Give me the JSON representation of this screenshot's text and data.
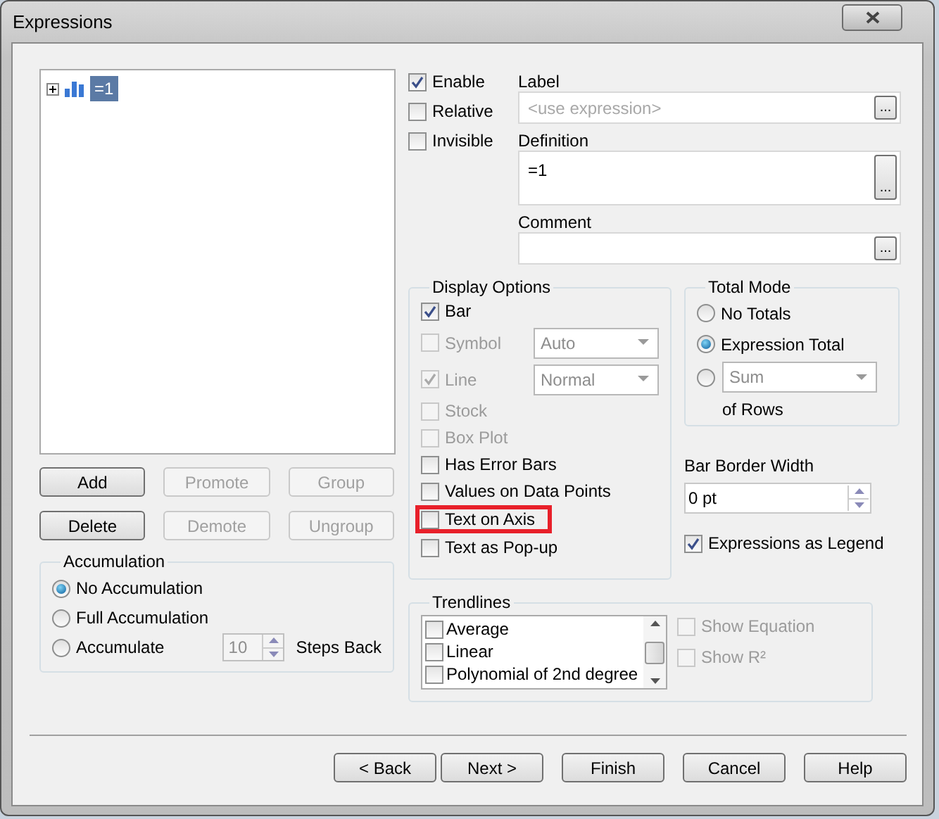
{
  "window": {
    "title": "Expressions"
  },
  "tree": {
    "items": [
      {
        "label": "=1",
        "selected": true,
        "expanded": false
      }
    ]
  },
  "list_buttons": [
    {
      "label": "Add",
      "disabled": false
    },
    {
      "label": "Promote",
      "disabled": true
    },
    {
      "label": "Group",
      "disabled": true
    },
    {
      "label": "Delete",
      "disabled": false
    },
    {
      "label": "Demote",
      "disabled": true
    },
    {
      "label": "Ungroup",
      "disabled": true
    }
  ],
  "accumulation": {
    "title": "Accumulation",
    "options": [
      {
        "label": "No Accumulation",
        "selected": true
      },
      {
        "label": "Full Accumulation",
        "selected": false
      },
      {
        "label": "Accumulate",
        "selected": false
      }
    ],
    "steps": {
      "value": "10",
      "label": "Steps Back",
      "disabled": true
    }
  },
  "flags": [
    {
      "label": "Enable",
      "checked": true
    },
    {
      "label": "Relative",
      "checked": false
    },
    {
      "label": "Invisible",
      "checked": false
    }
  ],
  "fields": [
    {
      "kind": "input",
      "label": "Label",
      "placeholder": "<use expression>",
      "button": "..."
    },
    {
      "kind": "textarea",
      "label": "Definition",
      "value": "=1",
      "button": "..."
    },
    {
      "kind": "input",
      "label": "Comment",
      "button": "..."
    }
  ],
  "display_options": {
    "title": "Display Options",
    "options": [
      {
        "kind": "check",
        "label": "Bar",
        "checked": true,
        "disabled": false,
        "highlighted": false
      },
      {
        "kind": "check_select",
        "label": "Symbol",
        "checked": false,
        "disabled": true,
        "select": "Auto",
        "highlighted": false
      },
      {
        "kind": "check_select",
        "label": "Line",
        "checked": true,
        "disabled": true,
        "select": "Normal",
        "highlighted": false
      },
      {
        "kind": "check",
        "label": "Stock",
        "checked": false,
        "disabled": true,
        "highlighted": false
      },
      {
        "kind": "check",
        "label": "Box Plot",
        "checked": false,
        "disabled": true,
        "highlighted": false
      },
      {
        "kind": "check",
        "label": "Has Error Bars",
        "checked": false,
        "disabled": false,
        "highlighted": false
      },
      {
        "kind": "check",
        "label": "Values on Data Points",
        "checked": false,
        "disabled": false,
        "highlighted": false
      },
      {
        "kind": "check",
        "label": "Text on Axis",
        "checked": false,
        "disabled": false,
        "highlighted": true
      },
      {
        "kind": "check",
        "label": "Text as Pop-up",
        "checked": false,
        "disabled": false,
        "highlighted": false
      }
    ]
  },
  "total_mode": {
    "title": "Total Mode",
    "options": [
      {
        "kind": "radio",
        "label": "No Totals",
        "selected": false
      },
      {
        "kind": "radio",
        "label": "Expression Total",
        "selected": true
      },
      {
        "kind": "radio_select",
        "select": "Sum",
        "suffix": "of Rows",
        "selected": false
      }
    ]
  },
  "bar_border_width": {
    "label": "Bar Border Width",
    "value": "0 pt"
  },
  "expressions_as_legend": {
    "label": "Expressions as Legend",
    "checked": true
  },
  "trendlines": {
    "title": "Trendlines",
    "items": [
      {
        "label": "Average",
        "checked": false
      },
      {
        "label": "Linear",
        "checked": false
      },
      {
        "label": "Polynomial of 2nd degree",
        "checked": false
      }
    ],
    "options": [
      {
        "label": "Show Equation",
        "checked": false,
        "disabled": true
      },
      {
        "label": "Show R²",
        "checked": false,
        "disabled": true
      }
    ]
  },
  "nav_buttons": [
    "< Back",
    "Next >"
  ],
  "footer_buttons": [
    "Finish",
    "Cancel",
    "Help"
  ]
}
